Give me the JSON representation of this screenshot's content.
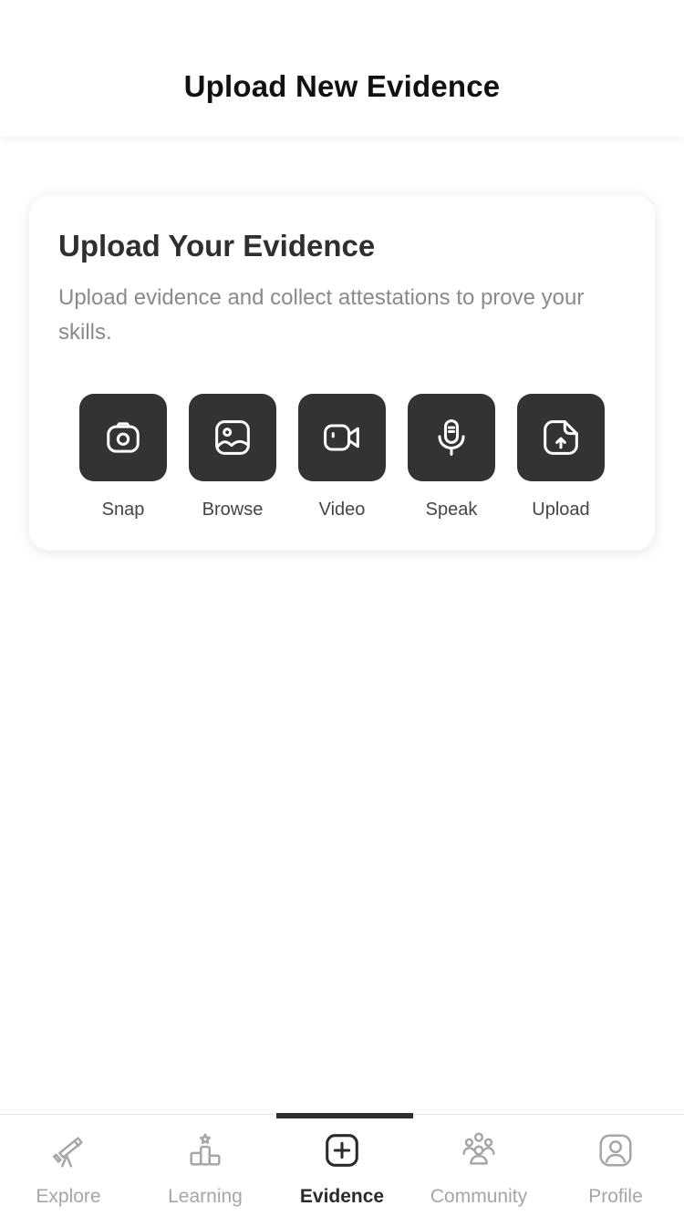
{
  "header": {
    "title": "Upload New Evidence"
  },
  "card": {
    "title": "Upload Your Evidence",
    "description": "Upload evidence and collect attestations to prove your skills.",
    "actions": [
      {
        "label": "Snap",
        "icon": "camera-icon"
      },
      {
        "label": "Browse",
        "icon": "image-icon"
      },
      {
        "label": "Video",
        "icon": "video-camera-icon"
      },
      {
        "label": "Speak",
        "icon": "microphone-icon"
      },
      {
        "label": "Upload",
        "icon": "file-upload-icon"
      }
    ]
  },
  "bottom_nav": {
    "active": "Evidence",
    "items": [
      {
        "label": "Explore",
        "icon": "telescope-icon"
      },
      {
        "label": "Learning",
        "icon": "podium-icon"
      },
      {
        "label": "Evidence",
        "icon": "plus-square-icon"
      },
      {
        "label": "Community",
        "icon": "people-icon"
      },
      {
        "label": "Profile",
        "icon": "user-icon"
      }
    ]
  },
  "colors": {
    "tile": "#333333",
    "active_text": "#2b2b2b",
    "inactive_text": "#a6a6a6",
    "description": "#8a8a8a"
  }
}
